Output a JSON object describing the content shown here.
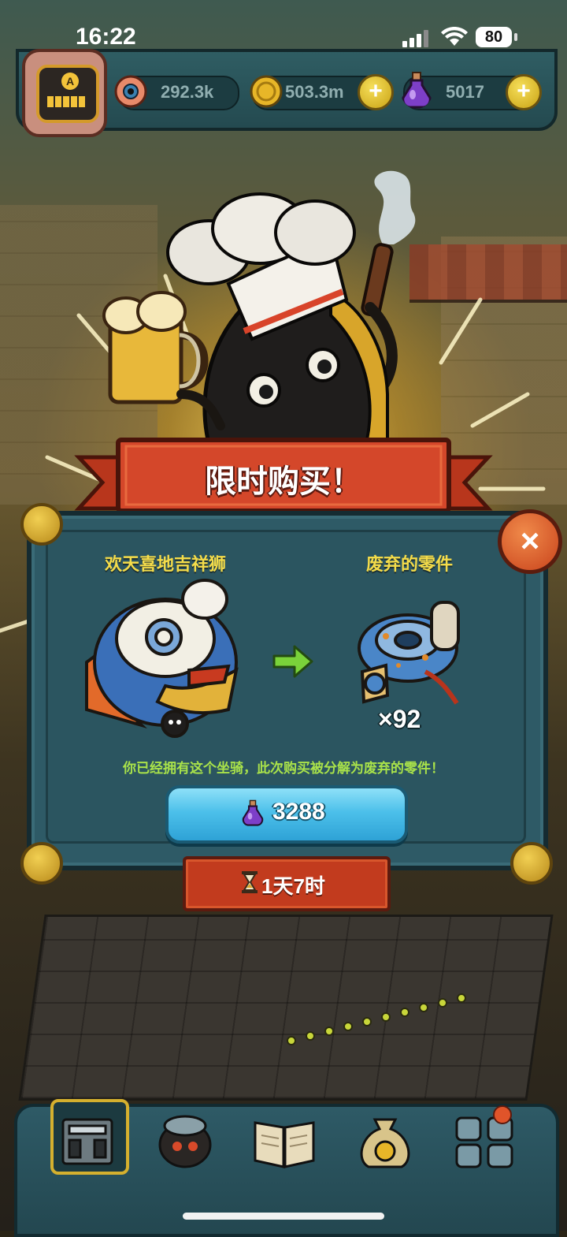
{
  "status_bar": {
    "time": "16:22",
    "battery": "80"
  },
  "resources": {
    "eyes": {
      "icon": "eyeball-icon",
      "value": "292.3k"
    },
    "coins": {
      "icon": "gold-coin-icon",
      "value": "503.3m"
    },
    "potions": {
      "icon": "potion-icon",
      "value": "5017"
    },
    "avatar_letter": "A"
  },
  "dialog": {
    "title": "限时购买！",
    "item_left_name": "欢天喜地吉祥狮",
    "item_right_name": "废弃的零件",
    "quantity": "×92",
    "notice": "你已经拥有这个坐骑，此次购买被分解为废弃的零件！",
    "price": "3288",
    "price_icon": "potion-icon",
    "timer": "1天7时",
    "close": "×"
  },
  "colors": {
    "accent_gold": "#f4dc4a",
    "notice_green": "#a9e24a",
    "banner_red": "#c23b1e",
    "button_blue": "#4cc0ea",
    "panel_teal": "#2e5a66"
  },
  "bottom_nav": [
    {
      "name": "kitchen-icon",
      "active": true
    },
    {
      "name": "monster-icon",
      "active": false
    },
    {
      "name": "book-icon",
      "active": false
    },
    {
      "name": "money-bag-icon",
      "active": false
    },
    {
      "name": "grid-menu-icon",
      "active": false,
      "badge": true
    }
  ]
}
